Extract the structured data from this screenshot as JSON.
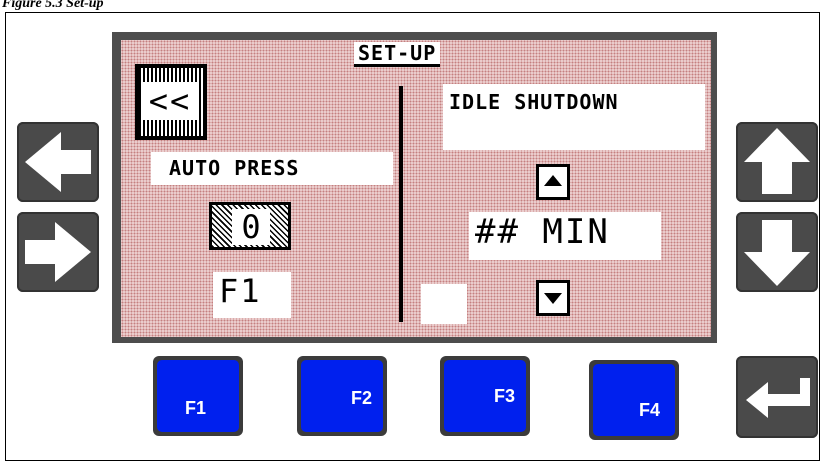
{
  "caption": "Figure 5.3 Set-up",
  "lcd": {
    "title": "SET-UP",
    "back_label": "<<",
    "left_label": "AUTO PRESS",
    "left_value": "0",
    "left_fkey": "F1",
    "right_label": "IDLE SHUTDOWN",
    "right_value": "## MIN"
  },
  "keys": {
    "f1": "F1",
    "f2": "F2",
    "f3": "F3",
    "f4": "F4"
  },
  "icons": {
    "left": "arrow-left-icon",
    "right": "arrow-right-icon",
    "up": "arrow-up-icon",
    "down": "arrow-down-icon",
    "enter": "enter-icon"
  },
  "colors": {
    "fkey_blue": "#0020ee",
    "button_gray": "#4a4a4a",
    "lcd_background": "#efd6d6"
  }
}
